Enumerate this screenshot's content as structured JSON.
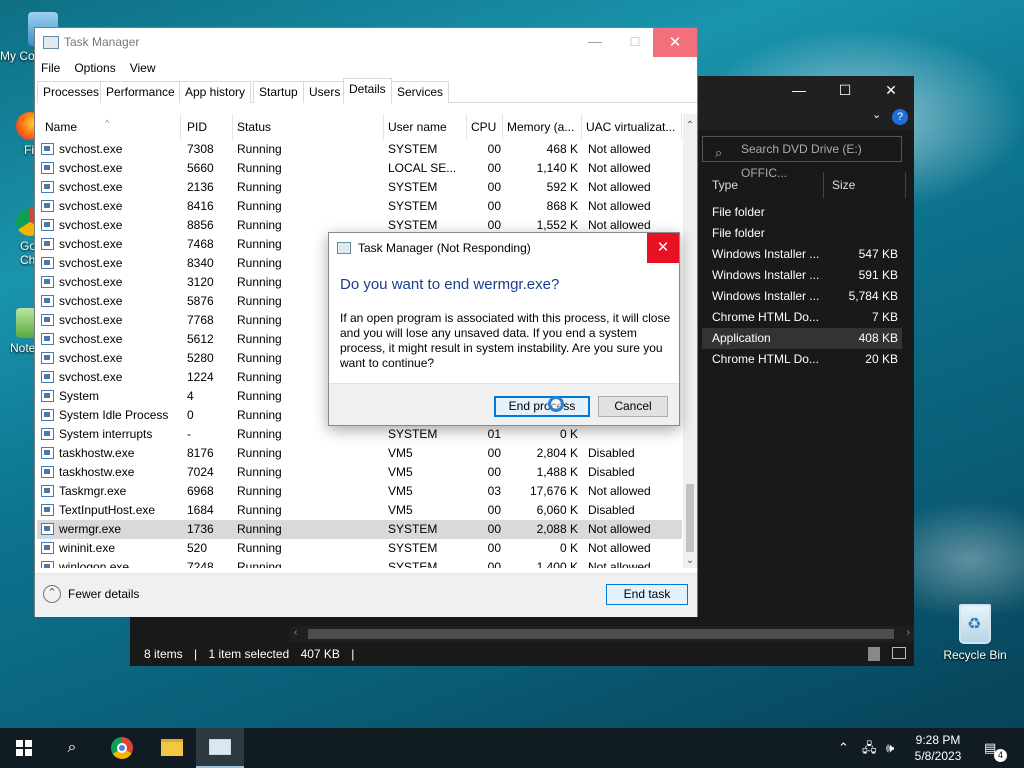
{
  "desktop": {
    "icons": [
      {
        "label": "My Co"
      },
      {
        "label": "Fi"
      },
      {
        "label": "Go\nCh"
      },
      {
        "label": "Note"
      }
    ],
    "recycle_bin": "Recycle Bin"
  },
  "explorer": {
    "search_placeholder": "Search DVD Drive (E:) OFFIC...",
    "columns": {
      "type": "Type",
      "size": "Size"
    },
    "rows": [
      {
        "type": "File folder",
        "size": ""
      },
      {
        "type": "File folder",
        "size": ""
      },
      {
        "type": "Windows Installer ...",
        "size": "547 KB"
      },
      {
        "type": "Windows Installer ...",
        "size": "591 KB"
      },
      {
        "type": "Windows Installer ...",
        "size": "5,784 KB"
      },
      {
        "type": "Chrome HTML Do...",
        "size": "7 KB"
      },
      {
        "type": "Application",
        "size": "408 KB"
      },
      {
        "type": "Chrome HTML Do...",
        "size": "20 KB"
      }
    ],
    "status": {
      "items": "8 items",
      "selected": "1 item selected",
      "size": "407 KB",
      "sep": "|"
    }
  },
  "taskmanager": {
    "title": "Task Manager",
    "menu": [
      "File",
      "Options",
      "View"
    ],
    "tabs": [
      "Processes",
      "Performance",
      "App history",
      "Startup",
      "Users",
      "Details",
      "Services"
    ],
    "columns": [
      "Name",
      "PID",
      "Status",
      "User name",
      "CPU",
      "Memory (a...",
      "UAC virtualizat..."
    ],
    "rows": [
      {
        "name": "svchost.exe",
        "pid": "7308",
        "status": "Running",
        "user": "SYSTEM",
        "cpu": "00",
        "mem": "468 K",
        "uac": "Not allowed"
      },
      {
        "name": "svchost.exe",
        "pid": "5660",
        "status": "Running",
        "user": "LOCAL SE...",
        "cpu": "00",
        "mem": "1,140 K",
        "uac": "Not allowed"
      },
      {
        "name": "svchost.exe",
        "pid": "2136",
        "status": "Running",
        "user": "SYSTEM",
        "cpu": "00",
        "mem": "592 K",
        "uac": "Not allowed"
      },
      {
        "name": "svchost.exe",
        "pid": "8416",
        "status": "Running",
        "user": "SYSTEM",
        "cpu": "00",
        "mem": "868 K",
        "uac": "Not allowed"
      },
      {
        "name": "svchost.exe",
        "pid": "8856",
        "status": "Running",
        "user": "SYSTEM",
        "cpu": "00",
        "mem": "1,552 K",
        "uac": "Not allowed"
      },
      {
        "name": "svchost.exe",
        "pid": "7468",
        "status": "Running",
        "user": "",
        "cpu": "",
        "mem": "",
        "uac": ""
      },
      {
        "name": "svchost.exe",
        "pid": "8340",
        "status": "Running",
        "user": "",
        "cpu": "",
        "mem": "",
        "uac": ""
      },
      {
        "name": "svchost.exe",
        "pid": "3120",
        "status": "Running",
        "user": "",
        "cpu": "",
        "mem": "",
        "uac": ""
      },
      {
        "name": "svchost.exe",
        "pid": "5876",
        "status": "Running",
        "user": "",
        "cpu": "",
        "mem": "",
        "uac": ""
      },
      {
        "name": "svchost.exe",
        "pid": "7768",
        "status": "Running",
        "user": "",
        "cpu": "",
        "mem": "",
        "uac": ""
      },
      {
        "name": "svchost.exe",
        "pid": "5612",
        "status": "Running",
        "user": "",
        "cpu": "",
        "mem": "",
        "uac": ""
      },
      {
        "name": "svchost.exe",
        "pid": "5280",
        "status": "Running",
        "user": "",
        "cpu": "",
        "mem": "",
        "uac": ""
      },
      {
        "name": "svchost.exe",
        "pid": "1224",
        "status": "Running",
        "user": "",
        "cpu": "",
        "mem": "",
        "uac": ""
      },
      {
        "name": "System",
        "pid": "4",
        "status": "Running",
        "user": "",
        "cpu": "",
        "mem": "",
        "uac": ""
      },
      {
        "name": "System Idle Process",
        "pid": "0",
        "status": "Running",
        "user": "",
        "cpu": "",
        "mem": "",
        "uac": ""
      },
      {
        "name": "System interrupts",
        "pid": "-",
        "status": "Running",
        "user": "SYSTEM",
        "cpu": "01",
        "mem": "0 K",
        "uac": ""
      },
      {
        "name": "taskhostw.exe",
        "pid": "8176",
        "status": "Running",
        "user": "VM5",
        "cpu": "00",
        "mem": "2,804 K",
        "uac": "Disabled"
      },
      {
        "name": "taskhostw.exe",
        "pid": "7024",
        "status": "Running",
        "user": "VM5",
        "cpu": "00",
        "mem": "1,488 K",
        "uac": "Disabled"
      },
      {
        "name": "Taskmgr.exe",
        "pid": "6968",
        "status": "Running",
        "user": "VM5",
        "cpu": "03",
        "mem": "17,676 K",
        "uac": "Not allowed"
      },
      {
        "name": "TextInputHost.exe",
        "pid": "1684",
        "status": "Running",
        "user": "VM5",
        "cpu": "00",
        "mem": "6,060 K",
        "uac": "Disabled"
      },
      {
        "name": "wermgr.exe",
        "pid": "1736",
        "status": "Running",
        "user": "SYSTEM",
        "cpu": "00",
        "mem": "2,088 K",
        "uac": "Not allowed",
        "selected": true
      },
      {
        "name": "wininit.exe",
        "pid": "520",
        "status": "Running",
        "user": "SYSTEM",
        "cpu": "00",
        "mem": "0 K",
        "uac": "Not allowed"
      },
      {
        "name": "winlogon.exe",
        "pid": "7248",
        "status": "Running",
        "user": "SYSTEM",
        "cpu": "00",
        "mem": "1,400 K",
        "uac": "Not allowed"
      }
    ],
    "fewer_details": "Fewer details",
    "end_task": "End task"
  },
  "dialog": {
    "title": "Task Manager (Not Responding)",
    "question": "Do you want to end wermgr.exe?",
    "message": "If an open program is associated with this process, it will close and you will lose any unsaved data. If you end a system process, it might result in system instability. Are you sure you want to continue?",
    "end_process": "End process",
    "cancel": "Cancel"
  },
  "taskbar": {
    "time": "9:28 PM",
    "date": "5/8/2023",
    "notifications": "4"
  },
  "colors": {
    "accent": "#0078d7",
    "close_red": "#e81123",
    "question_blue": "#1a3d8f"
  }
}
